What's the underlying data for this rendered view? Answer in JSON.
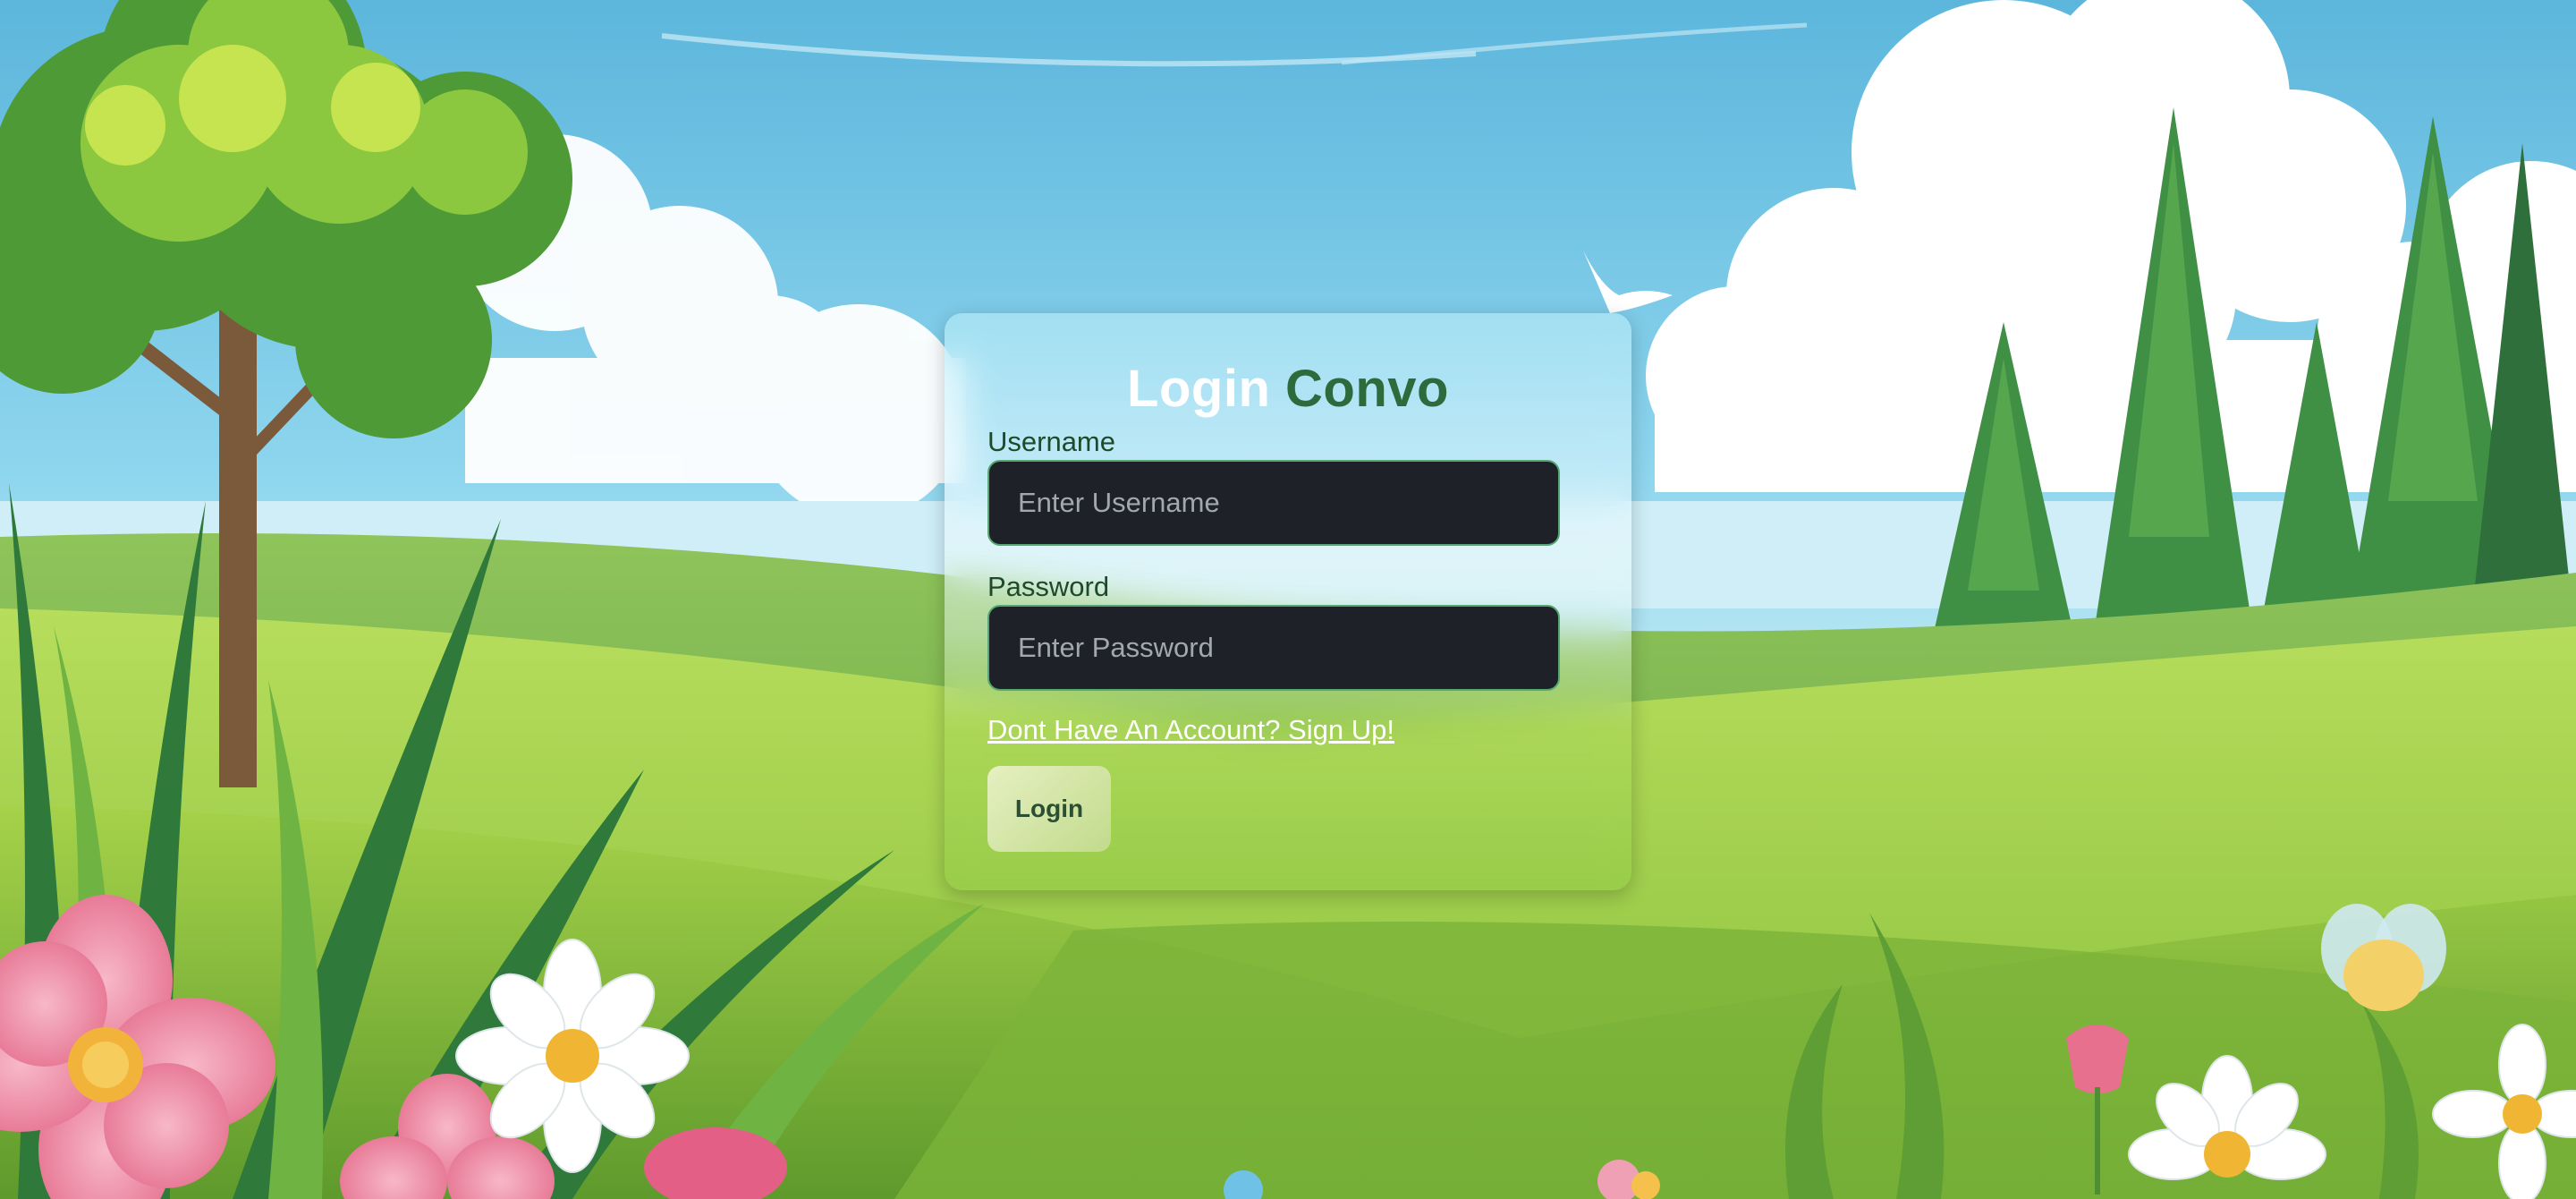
{
  "login": {
    "title_part1": "Login",
    "title_part2": "Convo",
    "username": {
      "label": "Username",
      "placeholder": "Enter Username",
      "value": ""
    },
    "password": {
      "label": "Password",
      "placeholder": "Enter Password",
      "value": ""
    },
    "signup_link": "Dont Have An Account? Sign Up!",
    "login_button": "Login"
  },
  "colors": {
    "title_accent": "#2e6b3c",
    "input_bg": "#1e2127",
    "input_border": "#56a873",
    "label_text": "#1f4a2a"
  }
}
